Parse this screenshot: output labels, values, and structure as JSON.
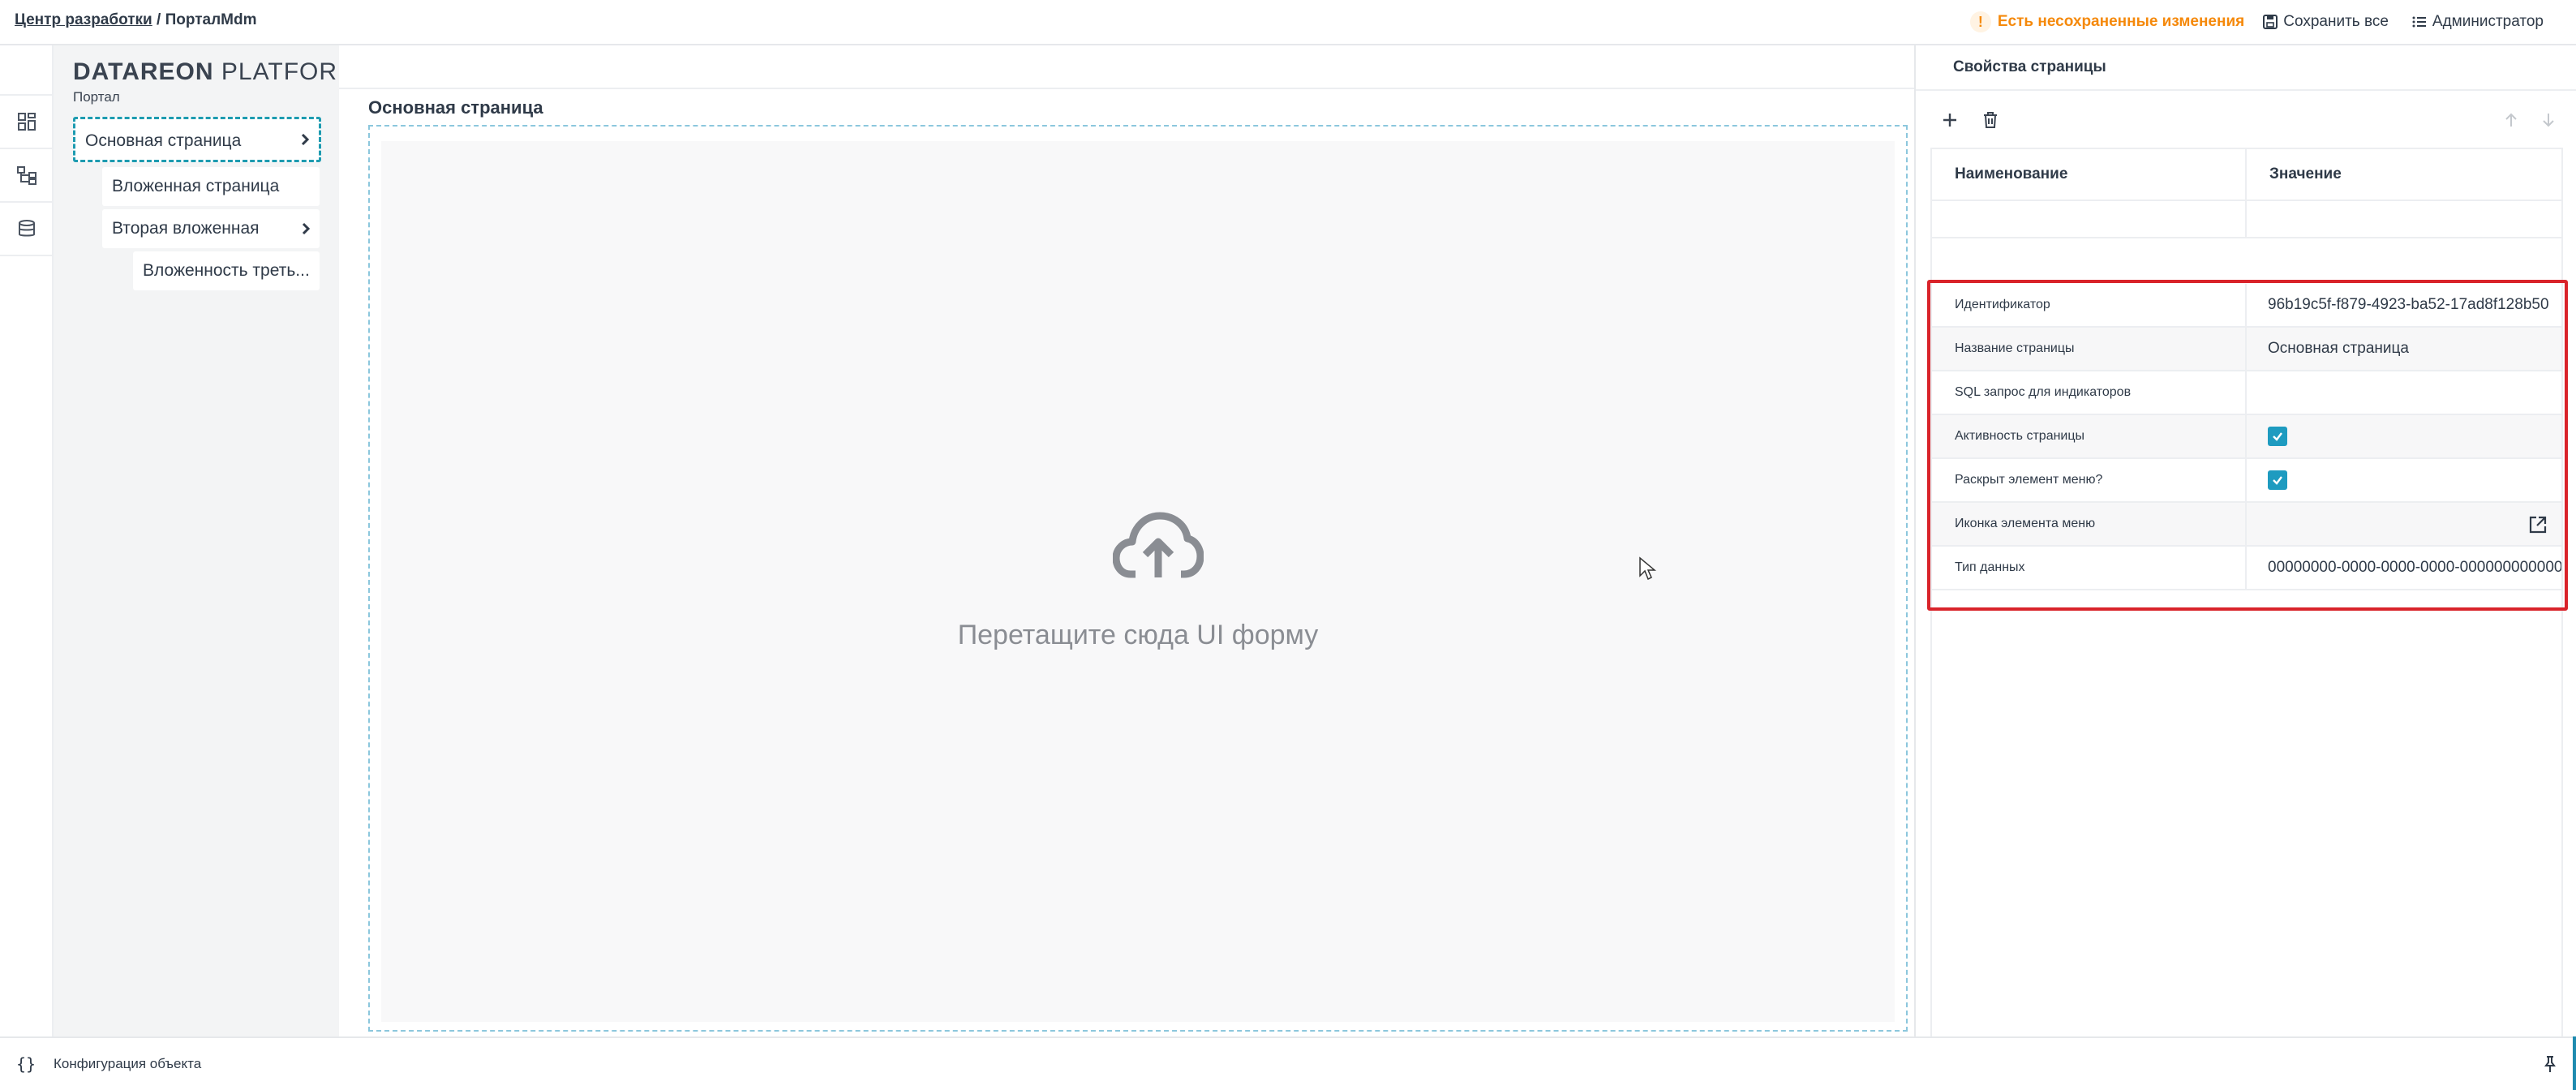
{
  "header": {
    "breadcrumb_link": "Центр разработки",
    "breadcrumb_sep": " / ",
    "breadcrumb_current": "ПорталMdm",
    "unsaved_icon": "!",
    "unsaved_text": "Есть несохраненные изменения",
    "save_all": "Сохранить все",
    "user": "Администратор"
  },
  "rail": {
    "icons": [
      "dashboard-icon",
      "hierarchy-icon",
      "database-icon"
    ]
  },
  "tree": {
    "logo_bold": "DATAREON",
    "logo_light": "PLATFORM",
    "portal_label": "Портал",
    "nodes": [
      {
        "label": "Основная страница",
        "modified_mark": "*",
        "has_children": true,
        "selected": true
      },
      {
        "label": "Вложенная страница",
        "has_children": false
      },
      {
        "label": "Вторая вложенная",
        "has_children": true
      },
      {
        "label": "Вложенность треть...",
        "has_children": false
      }
    ]
  },
  "canvas": {
    "page_title": "Основная страница",
    "drop_text": "Перетащите сюда UI форму"
  },
  "properties": {
    "title": "Свойства страницы",
    "col_name": "Наименование",
    "col_value": "Значение",
    "rows": [
      {
        "name": "Идентификатор",
        "value": "96b19c5f-f879-4923-ba52-17ad8f128b50"
      },
      {
        "name": "Название страницы",
        "value": "Основная страница"
      },
      {
        "name": "SQL запрос для индикаторов",
        "value": ""
      },
      {
        "name": "Активность страницы",
        "value": "",
        "checked": true
      },
      {
        "name": "Раскрыт элемент меню?",
        "value": "",
        "checked": true
      },
      {
        "name": "Иконка элемента меню",
        "value": ""
      },
      {
        "name": "Тип данных",
        "value": "00000000-0000-0000-0000-000000000000"
      }
    ]
  },
  "footer": {
    "icon": "{}",
    "label": "Конфигурация объекта"
  },
  "colors": {
    "accent": "#1e9bc0",
    "warning": "#f5890b",
    "highlight": "#d9232a"
  }
}
